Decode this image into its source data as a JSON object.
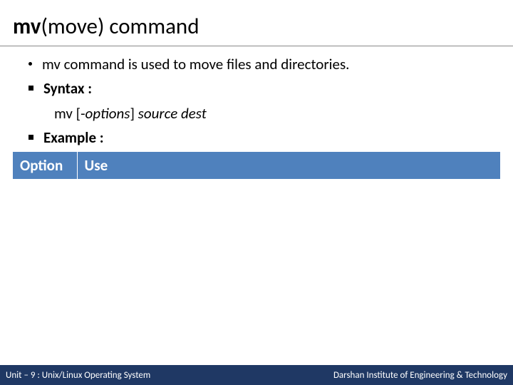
{
  "title": {
    "bold": "mv",
    "rest": "(move) command"
  },
  "bullets": {
    "intro": "mv command is used to move files and directories.",
    "syntax_label": "Syntax :",
    "syntax_cmd": "mv [-",
    "syntax_opt": "options",
    "syntax_mid": "] ",
    "syntax_args": "source dest",
    "example_label": "Example :"
  },
  "table": {
    "col1": "Option",
    "col2": "Use"
  },
  "footer": {
    "left": "Unit – 9 : Unix/Linux Operating System",
    "right": "Darshan Institute of Engineering & Technology"
  }
}
